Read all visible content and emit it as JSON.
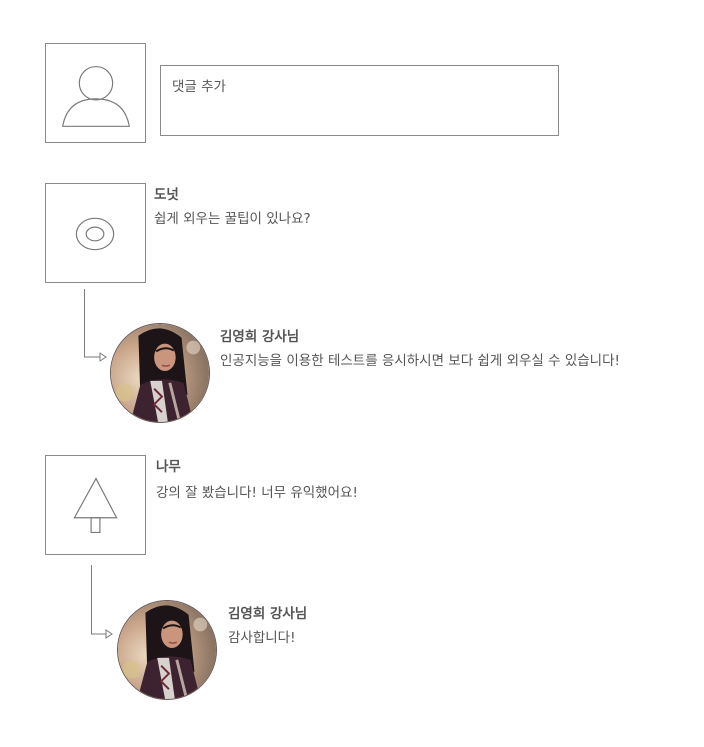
{
  "composer": {
    "placeholder": "댓글 추가",
    "avatar_icon": "user-silhouette-icon"
  },
  "comments": [
    {
      "author": "도넛",
      "text": "쉽게 외우는 꿀팁이 있나요?",
      "avatar_icon": "donut-icon",
      "reply": {
        "author": "김영희 강사님",
        "text": "인공지능을 이용한 테스트를 응시하시면 보다 쉽게 외우실 수 있습니다!"
      }
    },
    {
      "author": "나무",
      "text": "강의 잘 봤습니다! 너무 유익했어요!",
      "avatar_icon": "tree-icon",
      "reply": {
        "author": "김영희 강사님",
        "text": "감사합니다!"
      }
    }
  ]
}
